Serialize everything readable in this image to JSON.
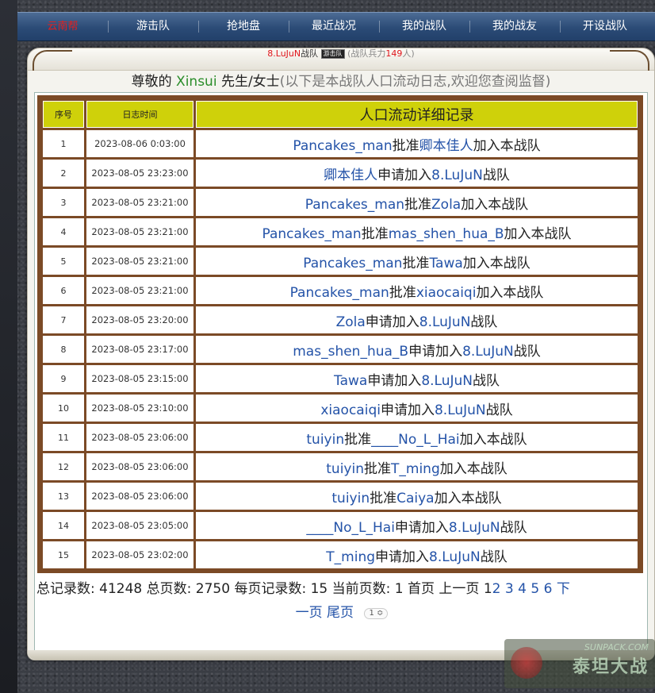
{
  "nav": {
    "items": [
      {
        "label": "云南帮",
        "active": true
      },
      {
        "label": "游击队"
      },
      {
        "label": "抢地盘"
      },
      {
        "label": "最近战况"
      },
      {
        "label": "我的战队"
      },
      {
        "label": "我的战友"
      },
      {
        "label": "开设战队"
      }
    ]
  },
  "team": {
    "name": "8.LuJuN",
    "label": "战队",
    "badge": "游击队",
    "strength_prefix": "(战队兵力",
    "strength_value": "149",
    "strength_suffix": "人)"
  },
  "greeting": {
    "prefix": "尊敬的 ",
    "name": "Xinsui",
    "suffix": " 先生/女士",
    "note": "(以下是本战队人口流动日志,欢迎您查阅监督)"
  },
  "table": {
    "headers": {
      "index": "序号",
      "time": "日志时间",
      "detail": "人口流动详细记录"
    },
    "rows": [
      {
        "index": "1",
        "time": "2023-08-06 0:03:00",
        "parts": [
          {
            "t": "Pancakes_man",
            "link": true
          },
          {
            "t": "批准"
          },
          {
            "t": "卿本佳人",
            "link": true
          },
          {
            "t": "加入本战队"
          }
        ]
      },
      {
        "index": "2",
        "time": "2023-08-05 23:23:00",
        "parts": [
          {
            "t": "卿本佳人",
            "link": true
          },
          {
            "t": "申请加入"
          },
          {
            "t": "8.LuJuN",
            "link": true
          },
          {
            "t": "战队"
          }
        ]
      },
      {
        "index": "3",
        "time": "2023-08-05 23:21:00",
        "parts": [
          {
            "t": "Pancakes_man",
            "link": true
          },
          {
            "t": "批准"
          },
          {
            "t": "Zola",
            "link": true
          },
          {
            "t": "加入本战队"
          }
        ]
      },
      {
        "index": "4",
        "time": "2023-08-05 23:21:00",
        "parts": [
          {
            "t": "Pancakes_man",
            "link": true
          },
          {
            "t": "批准"
          },
          {
            "t": "mas_shen_hua_B",
            "link": true
          },
          {
            "t": "加入本战队"
          }
        ]
      },
      {
        "index": "5",
        "time": "2023-08-05 23:21:00",
        "parts": [
          {
            "t": "Pancakes_man",
            "link": true
          },
          {
            "t": "批准"
          },
          {
            "t": "Tawa",
            "link": true
          },
          {
            "t": "加入本战队"
          }
        ]
      },
      {
        "index": "6",
        "time": "2023-08-05 23:21:00",
        "parts": [
          {
            "t": "Pancakes_man",
            "link": true
          },
          {
            "t": "批准"
          },
          {
            "t": "xiaocaiqi",
            "link": true
          },
          {
            "t": "加入本战队"
          }
        ]
      },
      {
        "index": "7",
        "time": "2023-08-05 23:20:00",
        "parts": [
          {
            "t": "Zola",
            "link": true
          },
          {
            "t": "申请加入"
          },
          {
            "t": "8.LuJuN",
            "link": true
          },
          {
            "t": "战队"
          }
        ]
      },
      {
        "index": "8",
        "time": "2023-08-05 23:17:00",
        "parts": [
          {
            "t": "mas_shen_hua_B",
            "link": true
          },
          {
            "t": "申请加入"
          },
          {
            "t": "8.LuJuN",
            "link": true
          },
          {
            "t": "战队"
          }
        ]
      },
      {
        "index": "9",
        "time": "2023-08-05 23:15:00",
        "parts": [
          {
            "t": "Tawa",
            "link": true
          },
          {
            "t": "申请加入"
          },
          {
            "t": "8.LuJuN",
            "link": true
          },
          {
            "t": "战队"
          }
        ]
      },
      {
        "index": "10",
        "time": "2023-08-05 23:10:00",
        "parts": [
          {
            "t": "xiaocaiqi",
            "link": true
          },
          {
            "t": "申请加入"
          },
          {
            "t": "8.LuJuN",
            "link": true
          },
          {
            "t": "战队"
          }
        ]
      },
      {
        "index": "11",
        "time": "2023-08-05 23:06:00",
        "parts": [
          {
            "t": "tuiyin",
            "link": true
          },
          {
            "t": "批准"
          },
          {
            "t": "____No_L_Hai",
            "link": true
          },
          {
            "t": "加入本战队"
          }
        ]
      },
      {
        "index": "12",
        "time": "2023-08-05 23:06:00",
        "parts": [
          {
            "t": "tuiyin",
            "link": true
          },
          {
            "t": "批准"
          },
          {
            "t": "T_ming",
            "link": true
          },
          {
            "t": "加入本战队"
          }
        ]
      },
      {
        "index": "13",
        "time": "2023-08-05 23:06:00",
        "parts": [
          {
            "t": "tuiyin",
            "link": true
          },
          {
            "t": "批准"
          },
          {
            "t": "Caiya",
            "link": true
          },
          {
            "t": "加入本战队"
          }
        ]
      },
      {
        "index": "14",
        "time": "2023-08-05 23:05:00",
        "parts": [
          {
            "t": "____No_L_Hai",
            "link": true
          },
          {
            "t": "申请加入"
          },
          {
            "t": "8.LuJuN",
            "link": true
          },
          {
            "t": "战队"
          }
        ]
      },
      {
        "index": "15",
        "time": "2023-08-05 23:02:00",
        "parts": [
          {
            "t": "T_ming",
            "link": true
          },
          {
            "t": "申请加入"
          },
          {
            "t": "8.LuJuN",
            "link": true
          },
          {
            "t": "战队"
          }
        ]
      }
    ]
  },
  "pager": {
    "total_records_label": "总记录数:",
    "total_records": "41248",
    "total_pages_label": "总页数:",
    "total_pages": "2750",
    "per_page_label": "每页记录数:",
    "per_page": "15",
    "current_label": "当前页数:",
    "current": "1",
    "first": "首页",
    "prev": "上一页",
    "pages": [
      "1",
      "2",
      "3",
      "4",
      "5",
      "6"
    ],
    "next_part1": "下",
    "next_part2": "一页",
    "last": "尾页",
    "select_value": "1 ≎"
  },
  "watermark": {
    "site": "SUNPACK.COM",
    "brand": "泰坦大战"
  },
  "colors": {
    "link": "#2453a8",
    "header_bg": "#cfd10a",
    "table_border": "#7b4a26",
    "nav_bg": "#2b4b76",
    "accent_red": "#e0161c",
    "greet_green": "#2a8d2a"
  }
}
